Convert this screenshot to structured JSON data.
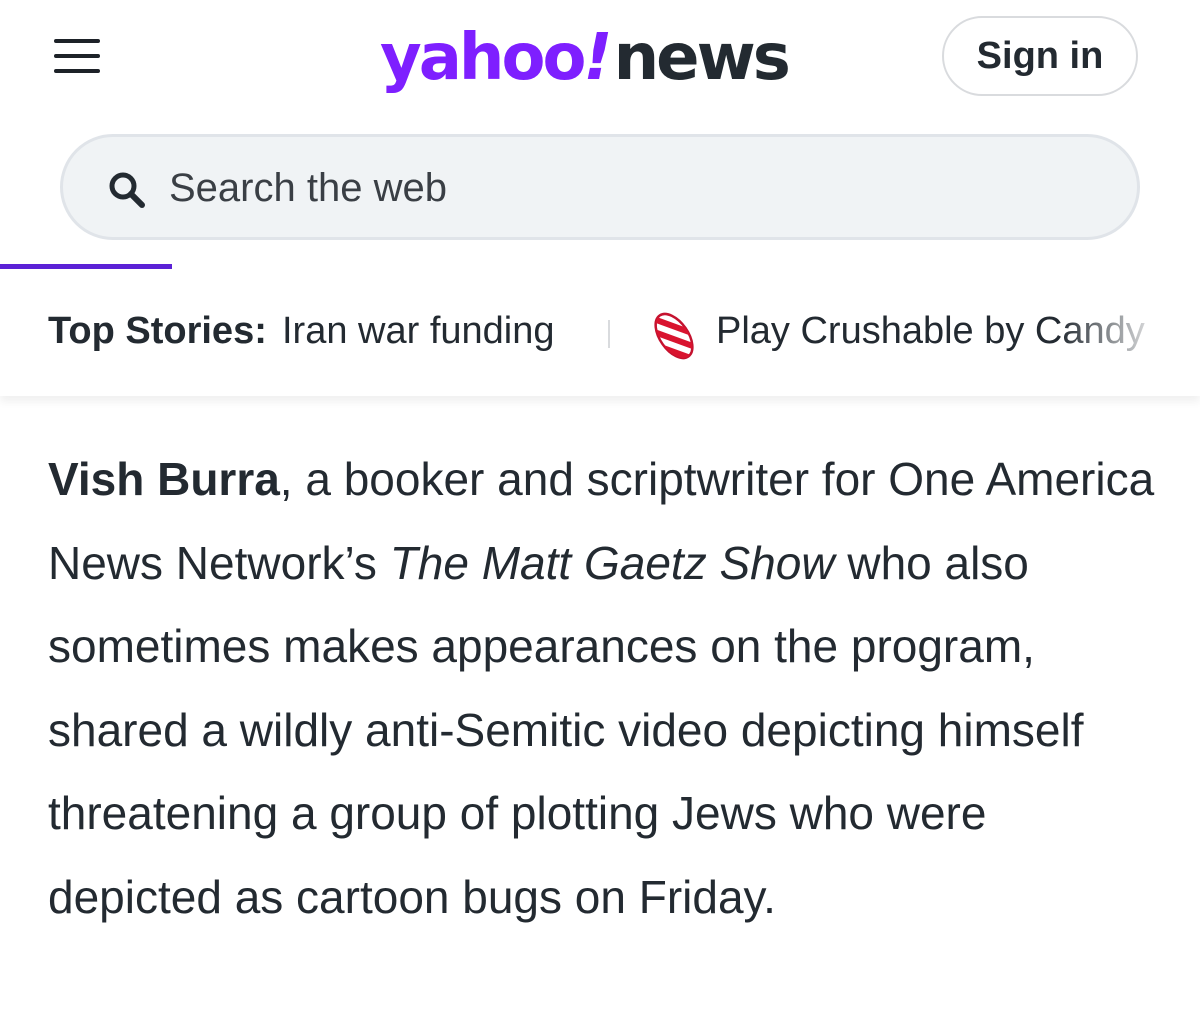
{
  "header": {
    "menu_icon": "hamburger-menu-icon",
    "logo": {
      "yahoo": "yahoo",
      "bang": "!",
      "news": "news",
      "brand_color": "#7e1fff"
    },
    "signin_label": "Sign in"
  },
  "search": {
    "icon": "search-icon",
    "placeholder": "Search the web",
    "value": ""
  },
  "accent_color": "#5b21d6",
  "top_stories": {
    "label": "Top Stories:",
    "link": "Iran war funding",
    "promo_icon": "candy-icon",
    "promo_text": "Play Crushable by Candy Crush"
  },
  "article": {
    "author": "Vish Burra",
    "part1": ", a booker and scriptwriter for One America News Network’s ",
    "show_title": "The Matt Gaetz Show",
    "part2": " who also sometimes makes appearances on the program, shared a wildly anti-Semitic video depicting himself threatening a group of plotting Jews who were depicted as cartoon bugs on Friday."
  }
}
